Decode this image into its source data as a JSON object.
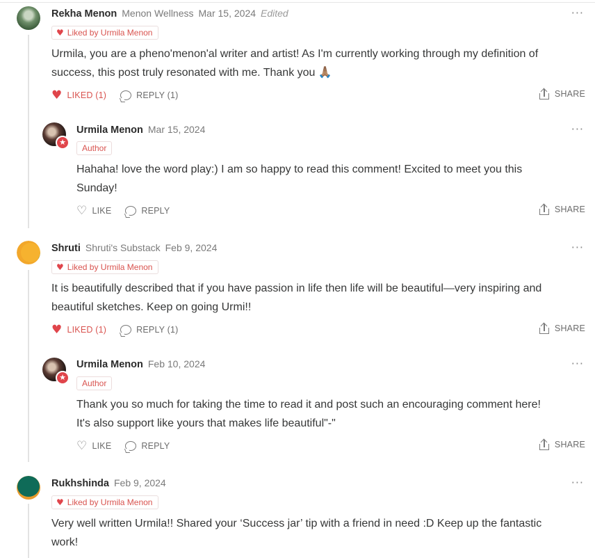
{
  "liked_by_text": "Liked by Urmila Menon",
  "author_badge": "Author",
  "share_label": "SHARE",
  "more_label": "···",
  "comments": [
    {
      "name": "Rekha Menon",
      "publication": "Menon Wellness",
      "date": "Mar 15, 2024",
      "edited": "Edited",
      "text1": "Urmila, you are a pheno'menon'al writer and artist! As I'm currently working through my definition of",
      "text2": "success, this post truly resonated with me. Thank you 🙏🏽",
      "like_label": "LIKED (1)",
      "reply_label": "REPLY (1)"
    },
    {
      "name": "Urmila Menon",
      "date": "Mar 15, 2024",
      "text1": "Hahaha! love the word play:) I am so happy to read this comment! Excited to meet you this",
      "text2": "Sunday!",
      "like_label": "LIKE",
      "reply_label": "REPLY"
    },
    {
      "name": "Shruti",
      "publication": "Shruti's Substack",
      "date": "Feb 9, 2024",
      "text1": "It is beautifully described that if you have passion in life then life will be beautiful—very inspiring and",
      "text2": "beautiful sketches. Keep on going Urmi!!",
      "like_label": "LIKED (1)",
      "reply_label": "REPLY (1)"
    },
    {
      "name": "Urmila Menon",
      "date": "Feb 10, 2024",
      "text1": "Thank you so much for taking the time to read it and post such an encouraging comment here!",
      "text2": "It's also support like yours that makes life beautiful\"-\"",
      "like_label": "LIKE",
      "reply_label": "REPLY"
    },
    {
      "name": "Rukhshinda",
      "date": "Feb 9, 2024",
      "text1": "Very well written Urmila!! Shared your ‘Success jar’ tip with a friend in need :D Keep up the fantastic",
      "text2": "work!"
    }
  ]
}
